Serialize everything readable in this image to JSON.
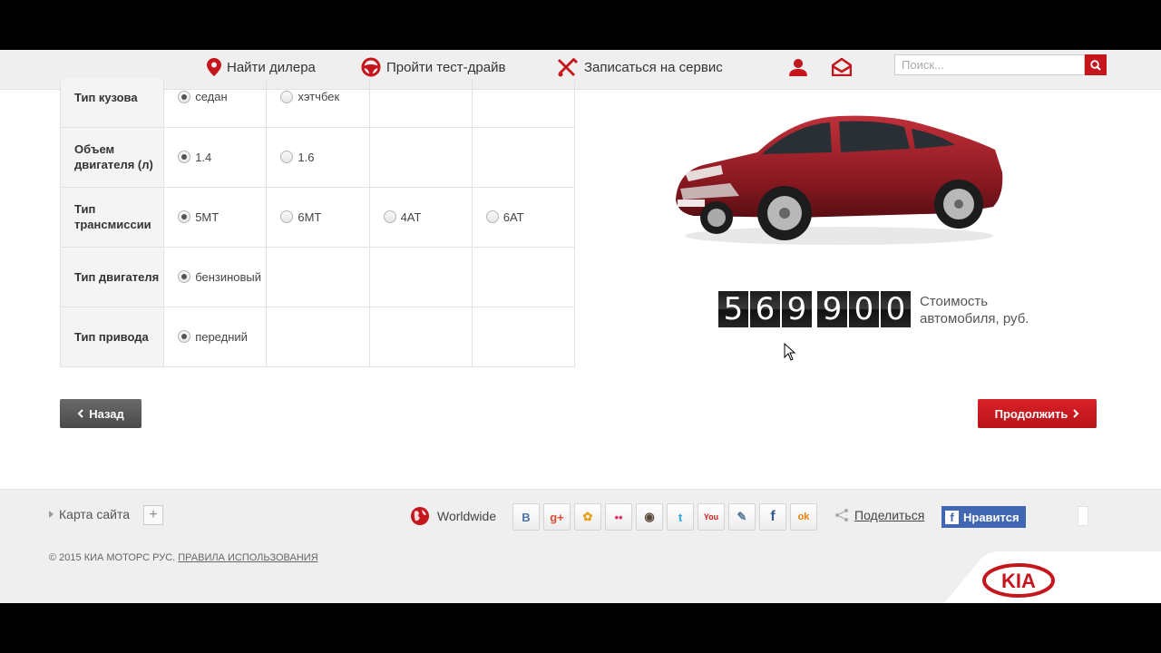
{
  "nav": {
    "dealer": "Найти дилера",
    "test_drive": "Пройти тест-драйв",
    "service": "Записаться на сервис",
    "search_placeholder": "Поиск..."
  },
  "options": [
    {
      "label": "Тип кузова",
      "choices": [
        {
          "text": "седан",
          "selected": true
        },
        {
          "text": "хэтчбек",
          "selected": false
        }
      ]
    },
    {
      "label": "Объем двигателя (л)",
      "choices": [
        {
          "text": "1.4",
          "selected": true
        },
        {
          "text": "1.6",
          "selected": false
        }
      ]
    },
    {
      "label": "Тип трансмиссии",
      "choices": [
        {
          "text": "5MT",
          "selected": true
        },
        {
          "text": "6MT",
          "selected": false
        },
        {
          "text": "4AT",
          "selected": false
        },
        {
          "text": "6AT",
          "selected": false
        }
      ]
    },
    {
      "label": "Тип двигателя",
      "choices": [
        {
          "text": "бензиновый",
          "selected": true
        }
      ]
    },
    {
      "label": "Тип привода",
      "choices": [
        {
          "text": "передний",
          "selected": true
        }
      ]
    }
  ],
  "price": {
    "digits": [
      "5",
      "6",
      "9",
      "9",
      "0",
      "0"
    ],
    "label": "Стоимость автомобиля, руб."
  },
  "buttons": {
    "back": "Назад",
    "next": "Продолжить"
  },
  "footer": {
    "sitemap": "Карта сайта",
    "plus": "+",
    "worldwide": "Worldwide",
    "share": "Поделиться",
    "fb_like": "Нравится",
    "copyright": "© 2015 КИА МОТОРС РУС.",
    "terms": "ПРАВИЛА ИСПОЛЬЗОВАНИЯ",
    "social": [
      {
        "glyph": "B",
        "color": "#4a76a8"
      },
      {
        "glyph": "g+",
        "color": "#dd4b39"
      },
      {
        "glyph": "✿",
        "color": "#e8a01a"
      },
      {
        "glyph": "••",
        "color": "#e0306a"
      },
      {
        "glyph": "◉",
        "color": "#5b4a3a"
      },
      {
        "glyph": "t",
        "color": "#2aa9e0"
      },
      {
        "glyph": "You",
        "color": "#d21d1d"
      },
      {
        "glyph": "✎",
        "color": "#557799"
      },
      {
        "glyph": "f",
        "color": "#3b5998"
      },
      {
        "glyph": "ok",
        "color": "#ee8208"
      }
    ],
    "logo": "KIA"
  },
  "colors": {
    "accent": "#c4161c",
    "back_button": "#555555",
    "facebook": "#4267b2"
  }
}
